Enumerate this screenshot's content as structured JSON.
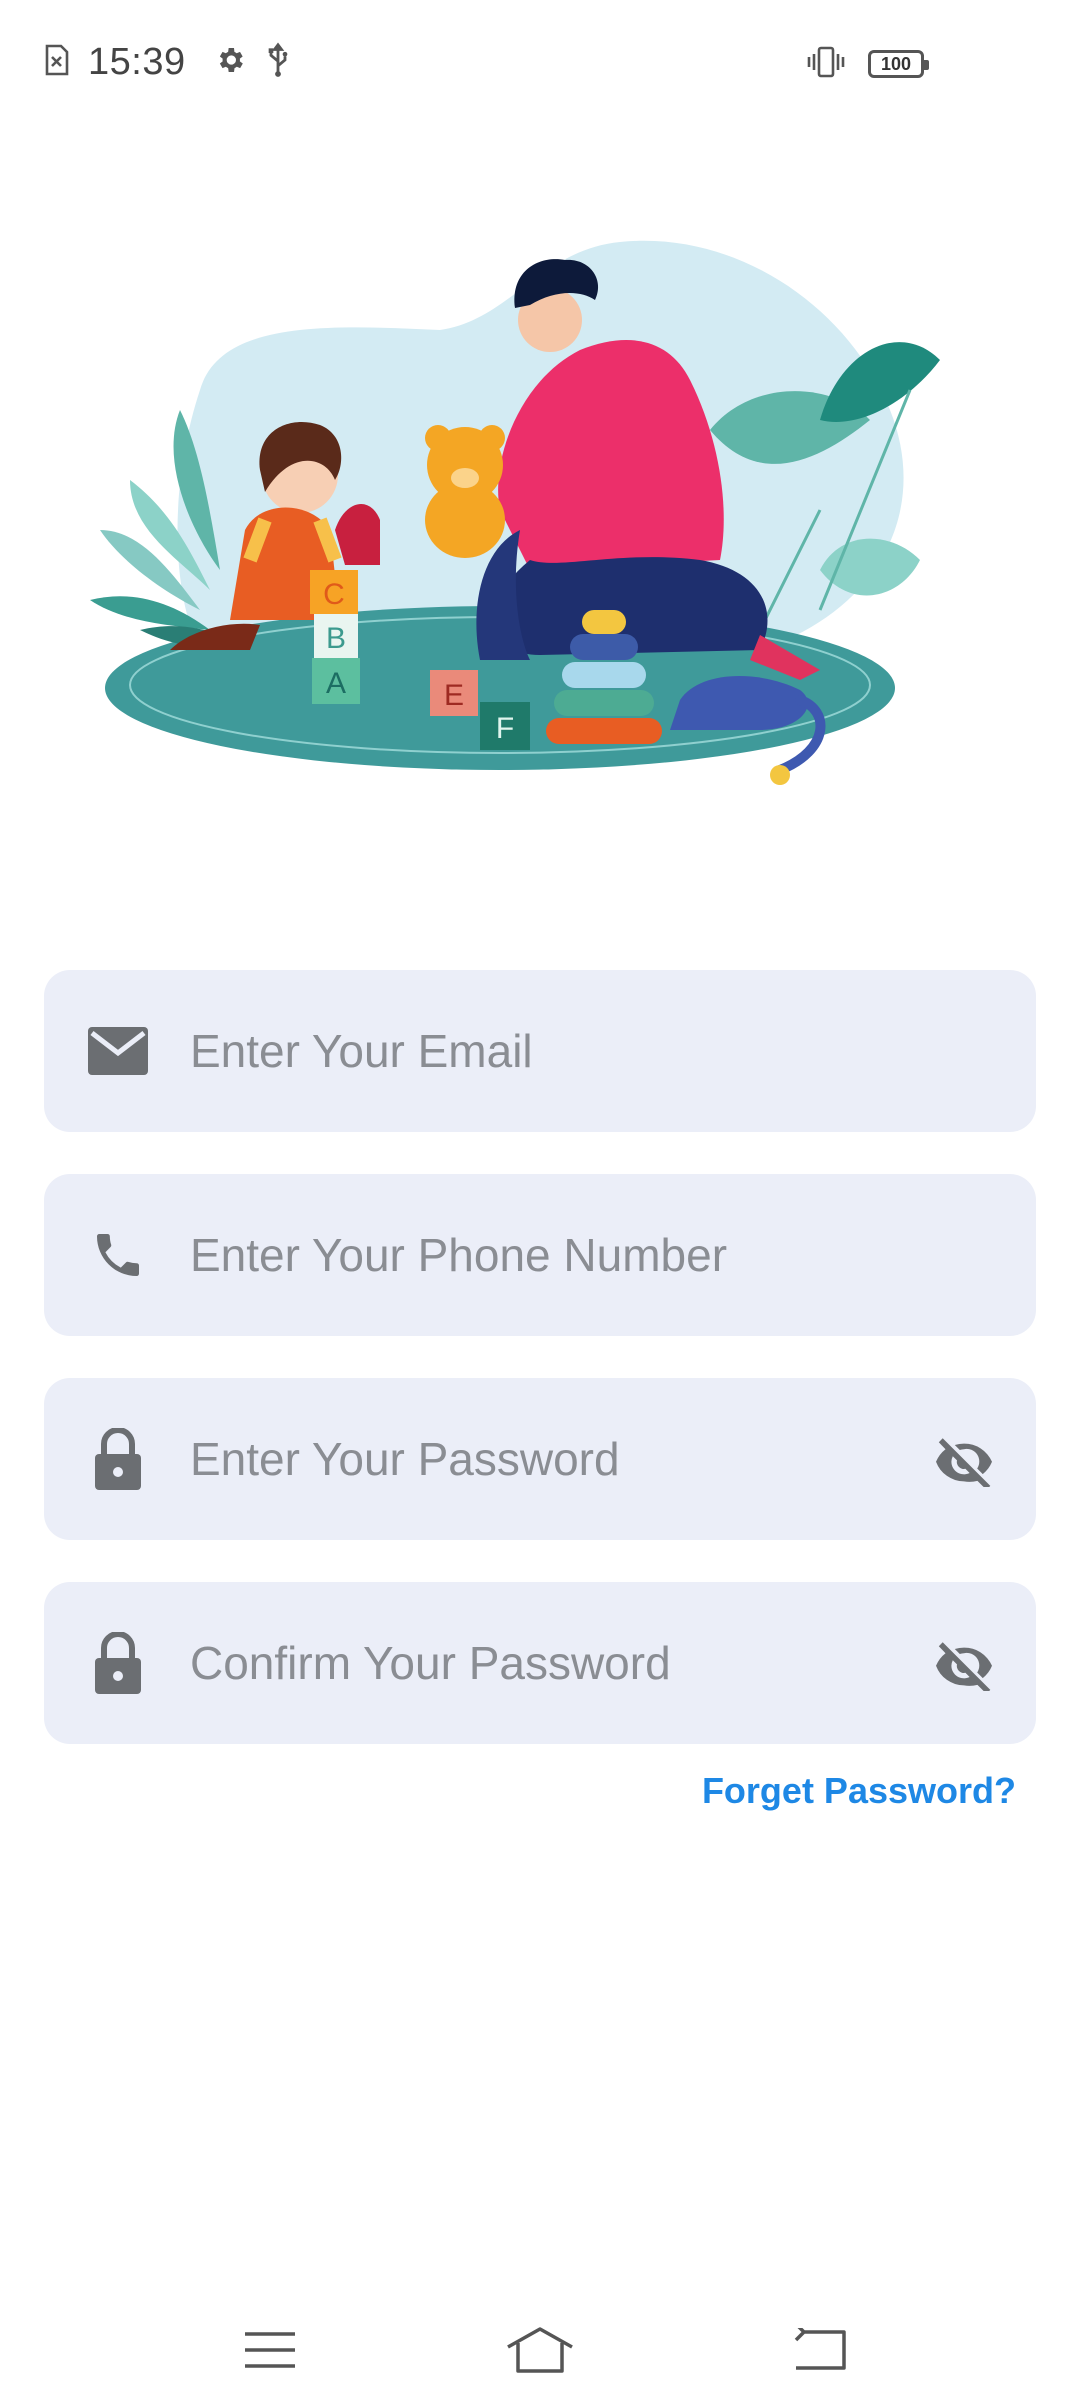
{
  "status_bar": {
    "time": "15:39",
    "battery_level": "100",
    "icons": [
      "sim-error-icon",
      "settings-icon",
      "usb-icon",
      "vibrate-icon",
      "battery-icon"
    ]
  },
  "form": {
    "email": {
      "placeholder": "Enter Your Email",
      "value": "",
      "icon": "email-icon"
    },
    "phone": {
      "placeholder": "Enter Your Phone Number",
      "value": "",
      "icon": "phone-icon"
    },
    "password": {
      "placeholder": "Enter Your Password",
      "value": "",
      "icon": "lock-icon",
      "toggle_icon": "visibility-off-icon"
    },
    "confirm_password": {
      "placeholder": "Confirm Your Password",
      "value": "",
      "icon": "lock-icon",
      "toggle_icon": "visibility-off-icon"
    },
    "forget_password_label": "Forget Password?"
  },
  "nav_bar": {
    "icons": [
      "menu-icon",
      "home-icon",
      "back-icon"
    ]
  },
  "colors": {
    "field_background": "#ebeef8",
    "link": "#1e88e5",
    "placeholder": "#8a8d93",
    "icon": "#6b6e72"
  }
}
